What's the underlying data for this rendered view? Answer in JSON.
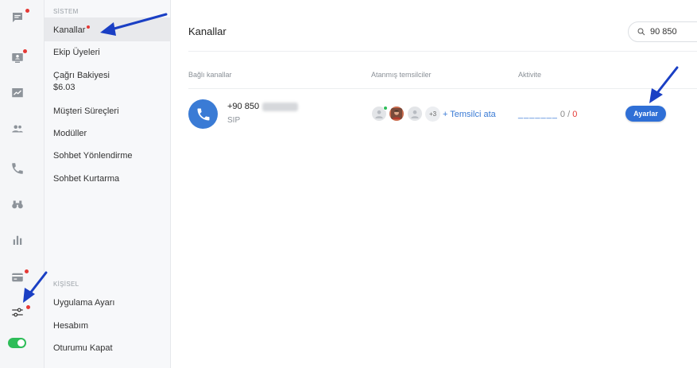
{
  "rail": {
    "toggle_on": true,
    "items": [
      {
        "icon": "chat-bubble-icon",
        "badge": true
      },
      {
        "icon": "monitor-user-icon",
        "badge": true
      },
      {
        "icon": "analytics-chart-icon",
        "badge": false
      },
      {
        "icon": "people-icon",
        "badge": false
      },
      {
        "icon": "phone-icon",
        "badge": false
      },
      {
        "icon": "binoculars-icon",
        "badge": false
      },
      {
        "icon": "bar-chart-icon",
        "badge": false
      },
      {
        "icon": "credit-card-icon",
        "badge": true
      },
      {
        "icon": "sliders-icon",
        "badge": true
      }
    ]
  },
  "nav": {
    "system_label": "SİSTEM",
    "system_items": [
      {
        "label": "Kanallar",
        "active": true,
        "badge": true
      },
      {
        "label": "Ekip Üyeleri"
      },
      {
        "label": "Çağrı Bakiyesi",
        "sub": "$6.03"
      },
      {
        "label": "Müşteri Süreçleri"
      },
      {
        "label": "Modüller"
      },
      {
        "label": "Sohbet Yönlendirme"
      },
      {
        "label": "Sohbet Kurtarma"
      }
    ],
    "personal_label": "KİŞİSEL",
    "personal_items": [
      {
        "label": "Uygulama Ayarı"
      },
      {
        "label": "Hesabım"
      },
      {
        "label": "Oturumu Kapat"
      }
    ]
  },
  "main": {
    "title": "Kanallar",
    "search": {
      "value": "90 850"
    },
    "columns": {
      "channels": "Bağlı kanallar",
      "agents": "Atanmış temsilciler",
      "activity": "Aktivite"
    },
    "channel": {
      "number": "+90 850",
      "type": "SIP",
      "more_agents": "+3",
      "assign_label": "+ Temsilci ata",
      "activity_dashes": "_______",
      "activity_value": "0",
      "activity_sep": "/",
      "activity_total": "0",
      "settings_button": "Ayarlar"
    }
  },
  "colors": {
    "accent": "#2f6fd6",
    "link": "#3a7bd5",
    "badge": "#e53935",
    "online": "#2ebd59",
    "annotation_arrow": "#1a3fc4"
  }
}
